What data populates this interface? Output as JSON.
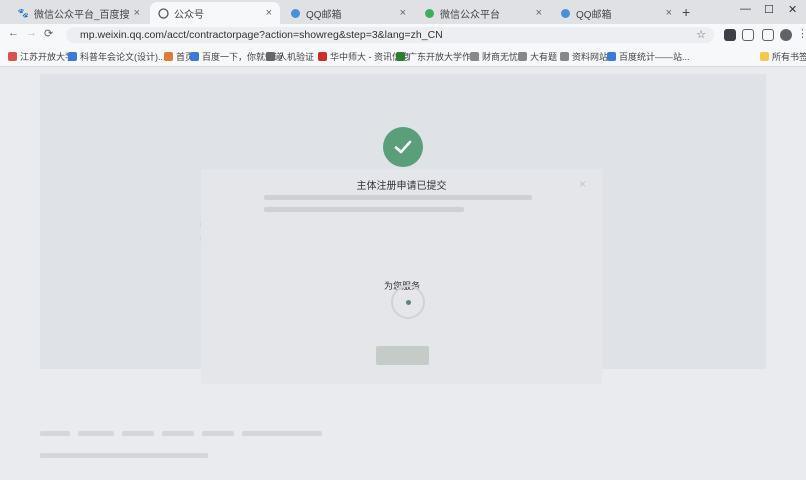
{
  "tabs": [
    {
      "label": "微信公众平台_百度搜索",
      "icon": "paw-icon",
      "active": false
    },
    {
      "label": "公众号",
      "icon": "wechat-icon",
      "active": true
    },
    {
      "label": "QQ邮箱",
      "icon": "qq-mail-icon",
      "active": false
    },
    {
      "label": "微信公众平台",
      "icon": "wechat-green-icon",
      "active": false
    },
    {
      "label": "QQ邮箱",
      "icon": "qq-mail-icon",
      "active": false
    }
  ],
  "window": {
    "minimize": "—",
    "maximize": "☐",
    "close": "✕",
    "new_tab": "+"
  },
  "address": {
    "url": "mp.weixin.qq.com/acct/contractorpage?action=showreg&step=3&lang=zh_CN"
  },
  "bookmarks": [
    "江苏开放大学",
    "科普年会论文(设计)...",
    "首页",
    "百度一下，你就知道",
    "人机验证",
    "华中师大 - 资讯信息",
    "广东开放大学作业",
    "财商无忧",
    "大有题",
    "资料网站",
    "百度统计——站..."
  ],
  "bookmarks_right": "所有书签",
  "modal": {
    "title": "主体注册申请已提交",
    "cursor_label": "为您服务"
  },
  "colors": {
    "accent_green": "#5a9e7a"
  }
}
